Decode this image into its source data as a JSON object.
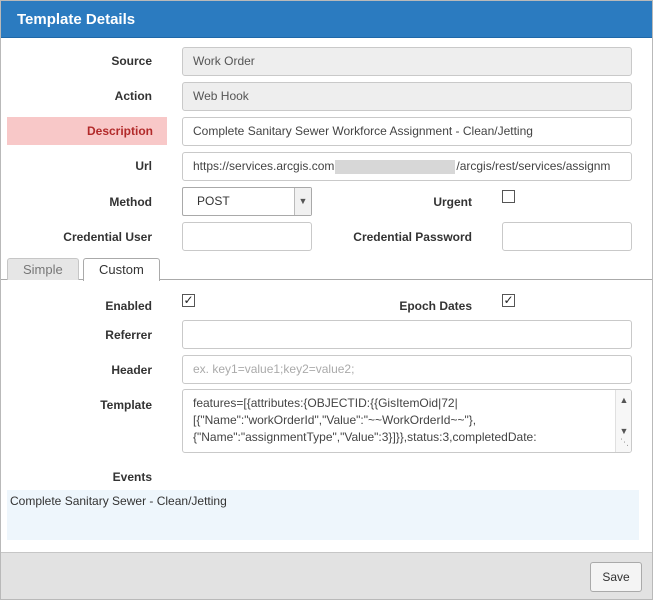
{
  "dialog": {
    "title": "Template Details"
  },
  "form": {
    "source": {
      "label": "Source",
      "value": "Work Order"
    },
    "action": {
      "label": "Action",
      "value": "Web Hook"
    },
    "description": {
      "label": "Description",
      "value": "Complete Sanitary Sewer Workforce Assignment - Clean/Jetting"
    },
    "url": {
      "label": "Url",
      "value_prefix": "https://services.arcgis.com",
      "value_suffix": "/arcgis/rest/services/assignm"
    },
    "method": {
      "label": "Method",
      "selected": "POST"
    },
    "urgent": {
      "label": "Urgent",
      "checked": false
    },
    "credential_user": {
      "label": "Credential User",
      "value": ""
    },
    "credential_password": {
      "label": "Credential Password",
      "value": ""
    }
  },
  "tabs": [
    {
      "label": "Simple",
      "active": false
    },
    {
      "label": "Custom",
      "active": true
    }
  ],
  "custom": {
    "enabled": {
      "label": "Enabled",
      "checked": true
    },
    "epoch_dates": {
      "label": "Epoch Dates",
      "checked": true
    },
    "referrer": {
      "label": "Referrer",
      "value": ""
    },
    "header": {
      "label": "Header",
      "placeholder": "ex. key1=value1;key2=value2;"
    },
    "template": {
      "label": "Template",
      "line1": "features=[{attributes:{OBJECTID:{{GisItemOid|72|",
      "line2": "[{\"Name\":\"workOrderId\",\"Value\":\"~~WorkOrderId~~\"},",
      "line3": "{\"Name\":\"assignmentType\",\"Value\":3}]}},status:3,completedDate:"
    },
    "events": {
      "label": "Events",
      "value": "Complete Sanitary Sewer - Clean/Jetting"
    }
  },
  "footer": {
    "save_label": "Save"
  },
  "colors": {
    "titlebar": "#2b7bc0",
    "error_bg": "#f8c8c8",
    "error_text": "#b22a2a",
    "events_bg": "#eef6fc"
  }
}
